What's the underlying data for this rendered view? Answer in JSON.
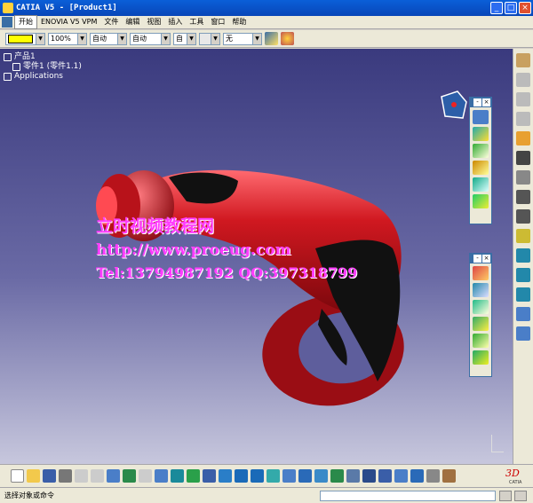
{
  "window": {
    "title": "CATIA V5 - [Product1]"
  },
  "menu": [
    "开始",
    "ENOVIA V5 VPM",
    "文件",
    "编辑",
    "视图",
    "插入",
    "工具",
    "窗口",
    "帮助"
  ],
  "toolbar": {
    "zoom_value": "100%",
    "combo1_value": "自动",
    "combo2_value": "自动",
    "combo3_value": "自",
    "combo4_value": "无"
  },
  "tree": {
    "root": "产品1",
    "child": "零件1 (零件1.1)",
    "applications": "Applications"
  },
  "watermark": {
    "line1": "立时视频教程网",
    "line2": "http://www.proeug.com",
    "line3": "Tel:13794987192  QQ:397318799"
  },
  "status": {
    "prompt": "选择对象或命令"
  },
  "colors": {
    "body_red": "#b5121b",
    "grip_black": "#111111",
    "watermark": "#ff3cff"
  },
  "icons": [
    "compass-icon",
    "product-icon",
    "part-icon",
    "applications-icon",
    "brand-logo-3ds"
  ]
}
